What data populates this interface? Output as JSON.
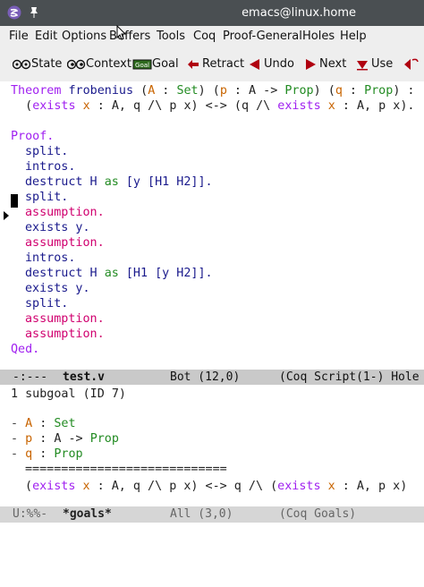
{
  "window": {
    "title": "emacs@linux.home"
  },
  "menu": [
    "File",
    "Edit",
    "Options",
    "Buffers",
    "Tools",
    "Coq",
    "Proof-General",
    "Holes",
    "Help"
  ],
  "toolbar": {
    "state": "State",
    "context": "Context",
    "goal": "Goal",
    "retract": "Retract",
    "undo": "Undo",
    "next": "Next",
    "use": "Use"
  },
  "editor": {
    "theorem_kw": "Theorem",
    "theorem_name": "frobenius",
    "proof_kw": "Proof.",
    "qed_kw": "Qed.",
    "tactics": [
      "split.",
      "intros.",
      "destruct H as [y [H1 H2]].",
      "split.",
      "assumption.",
      "exists y.",
      "assumption.",
      "intros.",
      "destruct H as [H1 [y H2]].",
      "exists y.",
      "split.",
      "assumption.",
      "assumption."
    ]
  },
  "modeline_main": {
    "status": "-:---",
    "buffer": "test.v",
    "position": "Bot (12,0)",
    "mode": "(Coq Script(1-) Hole"
  },
  "goals": {
    "header": "1 subgoal (ID 7)",
    "hyps": [
      {
        "name": "A",
        "type": "Set"
      },
      {
        "name": "p",
        "type": "A -> Prop"
      },
      {
        "name": "q",
        "type": "Prop"
      }
    ],
    "separator": "============================"
  },
  "modeline_goals": {
    "status": "U:%%-",
    "buffer": "*goals*",
    "position": "All (3,0)",
    "mode": "(Coq Goals)"
  },
  "colors": {
    "keyword": "#a020f0",
    "tactic": "#1a1a8c",
    "tactic_special": "#d0006f",
    "type": "#228b22",
    "variable": "#c86400"
  }
}
